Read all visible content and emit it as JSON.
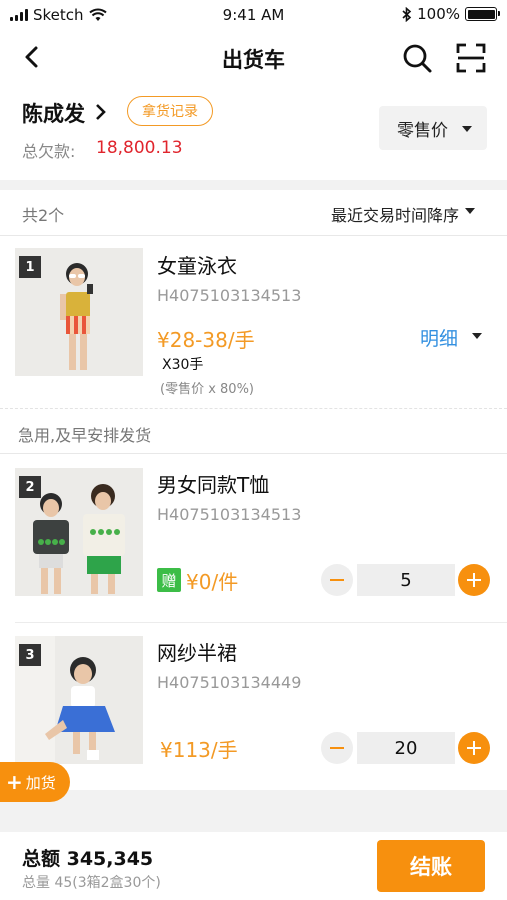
{
  "status_bar": {
    "carrier": "Sketch",
    "time": "9:41 AM",
    "battery": "100%"
  },
  "nav": {
    "title": "出货车"
  },
  "customer": {
    "name": "陈成发",
    "record_button": "拿货记录",
    "debt_label": "总欠款:",
    "debt_value": "18,800.13",
    "price_type": "零售价"
  },
  "list": {
    "count": "共2个",
    "sort": "最近交易时间降序"
  },
  "items": [
    {
      "index": "1",
      "name": "女童泳衣",
      "code": "H4075103134513",
      "price": "¥28-38/手",
      "qty_text": "X30手",
      "note": "(零售价 x 80%)",
      "detail": "明细",
      "remark": "急用,及早安排发货"
    },
    {
      "index": "2",
      "name": "男女同款T恤",
      "code": "H4075103134513",
      "gift_badge": "赠",
      "price": "¥0/件",
      "quantity": "5"
    },
    {
      "index": "3",
      "name": "网纱半裙",
      "code": "H4075103134449",
      "price": "¥113/手",
      "quantity": "20"
    }
  ],
  "add_goods": "加货",
  "footer": {
    "total": "总额 345,345",
    "total_qty": "总量 45(3箱2盒30个)",
    "checkout": "结账"
  },
  "colors": {
    "accent": "#f7900e",
    "debt": "#e0252d",
    "link": "#3390e0",
    "gift": "#3cbd47"
  }
}
